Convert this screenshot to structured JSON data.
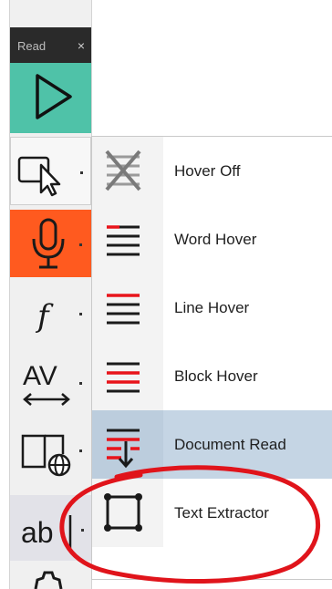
{
  "toolbar": {
    "title": "Read",
    "close": "×",
    "buttons": [
      {
        "id": "play",
        "icon": "play-icon"
      },
      {
        "id": "hover",
        "icon": "hover-pointer-icon"
      },
      {
        "id": "speech",
        "icon": "microphone-icon"
      },
      {
        "id": "formula",
        "icon": "function-icon"
      },
      {
        "id": "spacing",
        "icon": "character-spacing-icon"
      },
      {
        "id": "dictionary",
        "icon": "web-book-icon"
      },
      {
        "id": "text",
        "icon": "text-field-icon"
      },
      {
        "id": "settings",
        "icon": "gear-icon"
      }
    ],
    "colors": {
      "play_bg": "#4fc2a8",
      "speech_bg": "#ff5a1f",
      "header_bg": "#2a2a2a"
    }
  },
  "hover_menu": {
    "items": [
      {
        "label": "Hover Off",
        "icon": "hover-off-icon"
      },
      {
        "label": "Word Hover",
        "icon": "word-hover-icon"
      },
      {
        "label": "Line Hover",
        "icon": "line-hover-icon"
      },
      {
        "label": "Block Hover",
        "icon": "block-hover-icon"
      },
      {
        "label": "Document Read",
        "icon": "document-read-icon",
        "highlighted": true
      },
      {
        "label": "Text Extractor",
        "icon": "text-extractor-icon"
      }
    ],
    "colors": {
      "highlight": "#c5d5e4",
      "accent_red": "#e8141b"
    }
  },
  "annotation": {
    "shape": "ellipse",
    "color": "#e0141b"
  }
}
